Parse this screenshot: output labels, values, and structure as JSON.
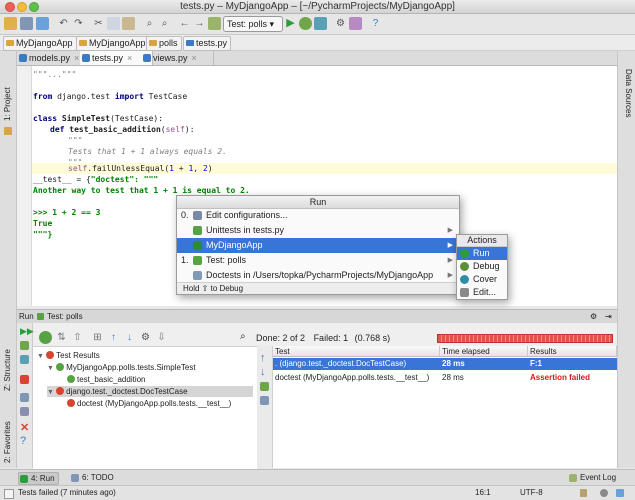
{
  "window": {
    "title": "tests.py – MyDjangoApp – [~/PycharmProjects/MyDjangoApp]"
  },
  "toolbar": {
    "run_config": "Test: polls"
  },
  "breadcrumbs": [
    "MyDjangoApp",
    "MyDjangoApp",
    "polls",
    "tests.py"
  ],
  "left_strip": {
    "project": "1: Project",
    "structure": "Z: Structure",
    "favorites": "2: Favorites"
  },
  "right_strip": {
    "data_sources": "Data Sources"
  },
  "tabs": [
    {
      "label": "models.py",
      "active": false
    },
    {
      "label": "tests.py",
      "active": true
    },
    {
      "label": "views.py",
      "active": false
    }
  ],
  "code": {
    "l1": "\"\"\"...\"\"\"",
    "l2_kw": "from",
    "l2_a": " django.test ",
    "l2_kw2": "import",
    "l2_b": " TestCase",
    "l3_kw": "class",
    "l3_name": " SimpleTest",
    "l3_rest": "(TestCase):",
    "l4_kw": "def",
    "l4_name": " test_basic_addition",
    "l4_rest": "(",
    "l4_self": "self",
    "l4_end": "):",
    "l5": "\"\"\"",
    "l6": "Tests that 1 + 1 always equals 2.",
    "l7": "\"\"\"",
    "l8_self": "self",
    "l8_rest": ".failUnlessEqual(",
    "l8_n1": "1",
    "l8_op": " + ",
    "l8_n2": "1",
    "l8_c": ", ",
    "l8_n3": "2",
    "l8_end": ")",
    "l9_a": "__test__ = {",
    "l9_s": "\"doctest\": \"\"\"",
    "l10": "Another way to test that 1 + 1 is equal to 2.",
    "l11": ">>> 1 + 2 == 3",
    "l12": "True",
    "l13": "\"\"\"}"
  },
  "popup": {
    "title": "Run",
    "items": [
      {
        "num": "0.",
        "label": "Edit configurations...",
        "icon_color": "#7a8aa6"
      },
      {
        "num": "",
        "label": "Unittests in tests.py",
        "icon_color": "#58a145"
      },
      {
        "num": "",
        "label": "MyDjangoApp",
        "icon_color": "#2d8a3a"
      },
      {
        "num": "1.",
        "label": "Test: polls",
        "icon_color": "#58a145"
      },
      {
        "num": "",
        "label": "Doctests in /Users/topka/PycharmProjects/MyDjangoApp",
        "icon_color": "#7f9ab8"
      }
    ],
    "hint": "Hold ⇧ to Debug"
  },
  "actions": {
    "title": "Actions",
    "items": [
      {
        "label": "Run",
        "icon_color": "#2b9e3b"
      },
      {
        "label": "Debug",
        "icon_color": "#5b8f3a"
      },
      {
        "label": "Cover",
        "icon_color": "#2e8fa4"
      },
      {
        "label": "Edit...",
        "icon_color": "#8a8a8a"
      }
    ]
  },
  "run_window": {
    "header_label": "Run",
    "config": "Test: polls",
    "done_text": "Done: 2 of 2",
    "failed_text": "Failed: 1",
    "time_text": "(0.768 s)",
    "tree": [
      {
        "label": "Test Results",
        "depth": 0,
        "icon_color": "#d9432f"
      },
      {
        "label": "MyDjangoApp.polls.tests.SimpleTest",
        "depth": 1,
        "icon_color": "#58a145"
      },
      {
        "label": "test_basic_addition",
        "depth": 2,
        "icon_color": "#58a145"
      },
      {
        "label": "django.test._doctest.DocTestCase",
        "depth": 1,
        "icon_color": "#d9432f"
      },
      {
        "label": "doctest (MyDjangoApp.polls.tests.__test__)",
        "depth": 2,
        "icon_color": "#d9432f"
      }
    ],
    "grid_columns": [
      "Test",
      "Time elapsed",
      "Results"
    ],
    "grid_rows": [
      {
        "test": ". (django.test._doctest.DocTestCase)",
        "time": "28 ms",
        "result": "F:1",
        "selected": true
      },
      {
        "test": "doctest (MyDjangoApp.polls.tests.__test__)",
        "time": "28 ms",
        "result": "Assertion failed",
        "selected": false
      }
    ]
  },
  "bottom_tabs": {
    "run": "4: Run",
    "todo": "6: TODO",
    "event_log": "Event Log"
  },
  "status": {
    "message": "Tests failed (7 minutes ago)",
    "position": "16:1",
    "encoding": "UTF-8"
  }
}
